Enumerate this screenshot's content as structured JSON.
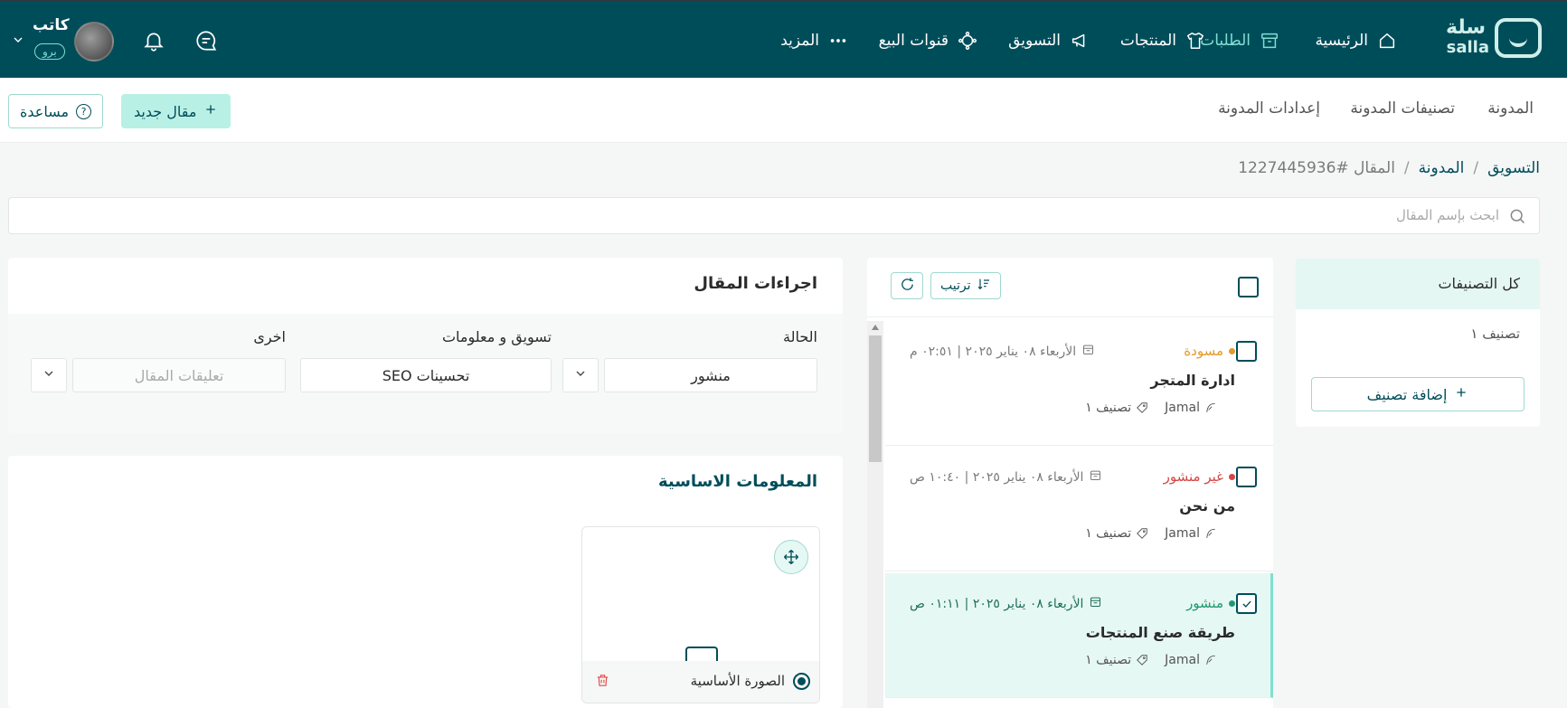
{
  "brand": {
    "name_ar": "سلة",
    "name_en": "salla"
  },
  "nav": {
    "items": [
      {
        "label": "الرئيسية",
        "icon": "home-icon"
      },
      {
        "label": "الطلبات",
        "icon": "orders-box-icon",
        "active": true
      },
      {
        "label": "المنتجات",
        "icon": "tshirt-icon"
      },
      {
        "label": "التسويق",
        "icon": "megaphone-icon"
      },
      {
        "label": "قنوات البيع",
        "icon": "channels-icon"
      },
      {
        "label": "المزيد",
        "icon": "more-dots-icon"
      }
    ],
    "active_color": "#7fe0d2"
  },
  "user": {
    "name": "كاتب",
    "badge": "برو"
  },
  "subheader": {
    "tabs": [
      "المدونة",
      "تصنيفات المدونة",
      "إعدادات المدونة"
    ],
    "new_button": "مقال جديد",
    "help_button": "مساعدة"
  },
  "breadcrumb": {
    "items": [
      "التسويق",
      "المدونة"
    ],
    "current": "المقال #1227445936"
  },
  "search": {
    "placeholder": "ابحث بإسم المقال"
  },
  "categories": {
    "all_label": "كل التصنيفات",
    "items": [
      "تصنيف ١"
    ],
    "add_button": "إضافة تصنيف"
  },
  "list": {
    "sort_label": "ترتيب",
    "articles": [
      {
        "status": "مسودة",
        "status_color": "#e29a2b",
        "date": "الأربعاء ٠٨ يناير ٢٠٢٥ | ٠٢:٥١ م",
        "title": "ادارة المتجر",
        "author": "Jamal",
        "category": "تصنيف ١",
        "selected": false
      },
      {
        "status": "غير منشور",
        "status_color": "#d64545",
        "date": "الأربعاء ٠٨ يناير ٢٠٢٥ | ١٠:٤٠ ص",
        "title": "من نحن",
        "author": "Jamal",
        "category": "تصنيف ١",
        "selected": false
      },
      {
        "status": "منشور",
        "status_color": "#1f9a6e",
        "date": "الأربعاء ٠٨ يناير ٢٠٢٥ | ٠١:١١ ص",
        "title": "طريقة صنع المنتجات",
        "author": "Jamal",
        "category": "تصنيف ١",
        "selected": true
      }
    ]
  },
  "actions_panel": {
    "title": "اجراءات المقال",
    "status_label": "الحالة",
    "status_value": "منشور",
    "marketing_label": "تسويق و معلومات",
    "marketing_value": "تحسينات SEO",
    "other_label": "اخرى",
    "comments_placeholder": "تعليقات المقال"
  },
  "basic_panel": {
    "title": "المعلومات الاساسية",
    "image_label": "الصورة الأساسية"
  },
  "colors": {
    "primary": "#004d5a",
    "accent": "#b9f0e6",
    "selected_bg": "#e6f8f3"
  }
}
